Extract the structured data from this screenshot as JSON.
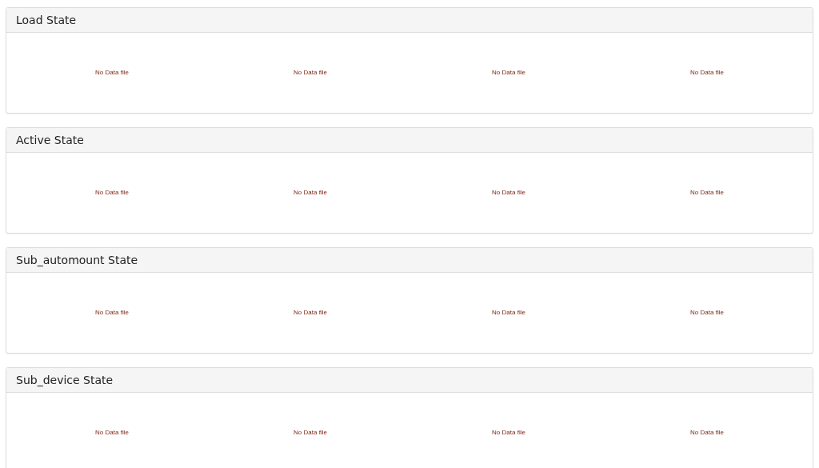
{
  "panels": [
    {
      "title": "Load State",
      "charts": [
        "No Data file",
        "No Data file",
        "No Data file",
        "No Data file"
      ]
    },
    {
      "title": "Active State",
      "charts": [
        "No Data file",
        "No Data file",
        "No Data file",
        "No Data file"
      ]
    },
    {
      "title": "Sub_automount State",
      "charts": [
        "No Data file",
        "No Data file",
        "No Data file",
        "No Data file"
      ]
    },
    {
      "title": "Sub_device State",
      "charts": [
        "No Data file",
        "No Data file",
        "No Data file",
        "No Data file"
      ]
    }
  ]
}
